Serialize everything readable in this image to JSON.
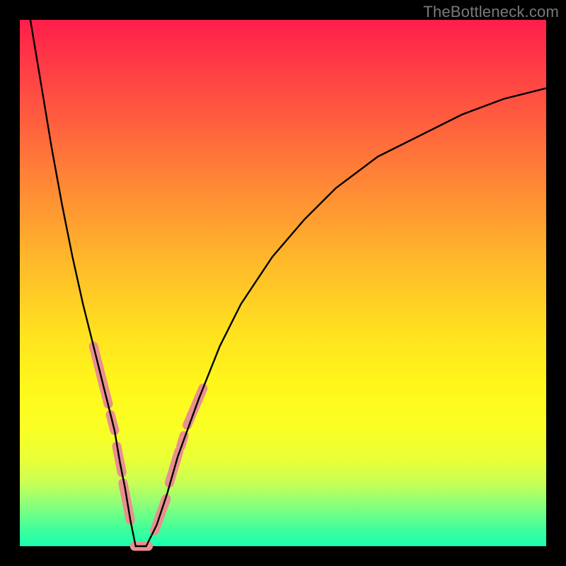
{
  "watermark": "TheBottleneck.com",
  "chart_data": {
    "type": "line",
    "title": "",
    "xlabel": "",
    "ylabel": "",
    "xlim": [
      0,
      100
    ],
    "ylim": [
      0,
      100
    ],
    "grid": false,
    "series": [
      {
        "name": "bottleneck-curve",
        "color": "#000000",
        "x": [
          2,
          4,
          6,
          8,
          10,
          12,
          14,
          16,
          18,
          19,
          20,
          21,
          22,
          24,
          26,
          28,
          30,
          34,
          38,
          42,
          48,
          54,
          60,
          68,
          76,
          84,
          92,
          100
        ],
        "y": [
          100,
          88,
          76,
          65,
          55,
          46,
          38,
          30,
          22,
          16,
          11,
          5,
          0,
          0,
          4,
          10,
          17,
          28,
          38,
          46,
          55,
          62,
          68,
          74,
          78,
          82,
          85,
          87
        ]
      }
    ],
    "markers": [
      {
        "name": "highlight-segments",
        "color": "#e98f8f",
        "stroke_width_px": 13,
        "segments": [
          {
            "x": [
              14.0,
              16.8
            ],
            "y": [
              38,
              27
            ]
          },
          {
            "x": [
              17.2,
              18.0
            ],
            "y": [
              25,
              22
            ]
          },
          {
            "x": [
              18.4,
              19.4
            ],
            "y": [
              19,
              14
            ]
          },
          {
            "x": [
              19.6,
              21.0
            ],
            "y": [
              12,
              5
            ]
          },
          {
            "x": [
              21.8,
              24.4
            ],
            "y": [
              0,
              0
            ]
          },
          {
            "x": [
              25.6,
              27.8
            ],
            "y": [
              3,
              9
            ]
          },
          {
            "x": [
              28.4,
              30.2
            ],
            "y": [
              12,
              18
            ]
          },
          {
            "x": [
              30.6,
              31.2
            ],
            "y": [
              19,
              21
            ]
          },
          {
            "x": [
              31.8,
              34.8
            ],
            "y": [
              23,
              30
            ]
          }
        ]
      }
    ]
  }
}
